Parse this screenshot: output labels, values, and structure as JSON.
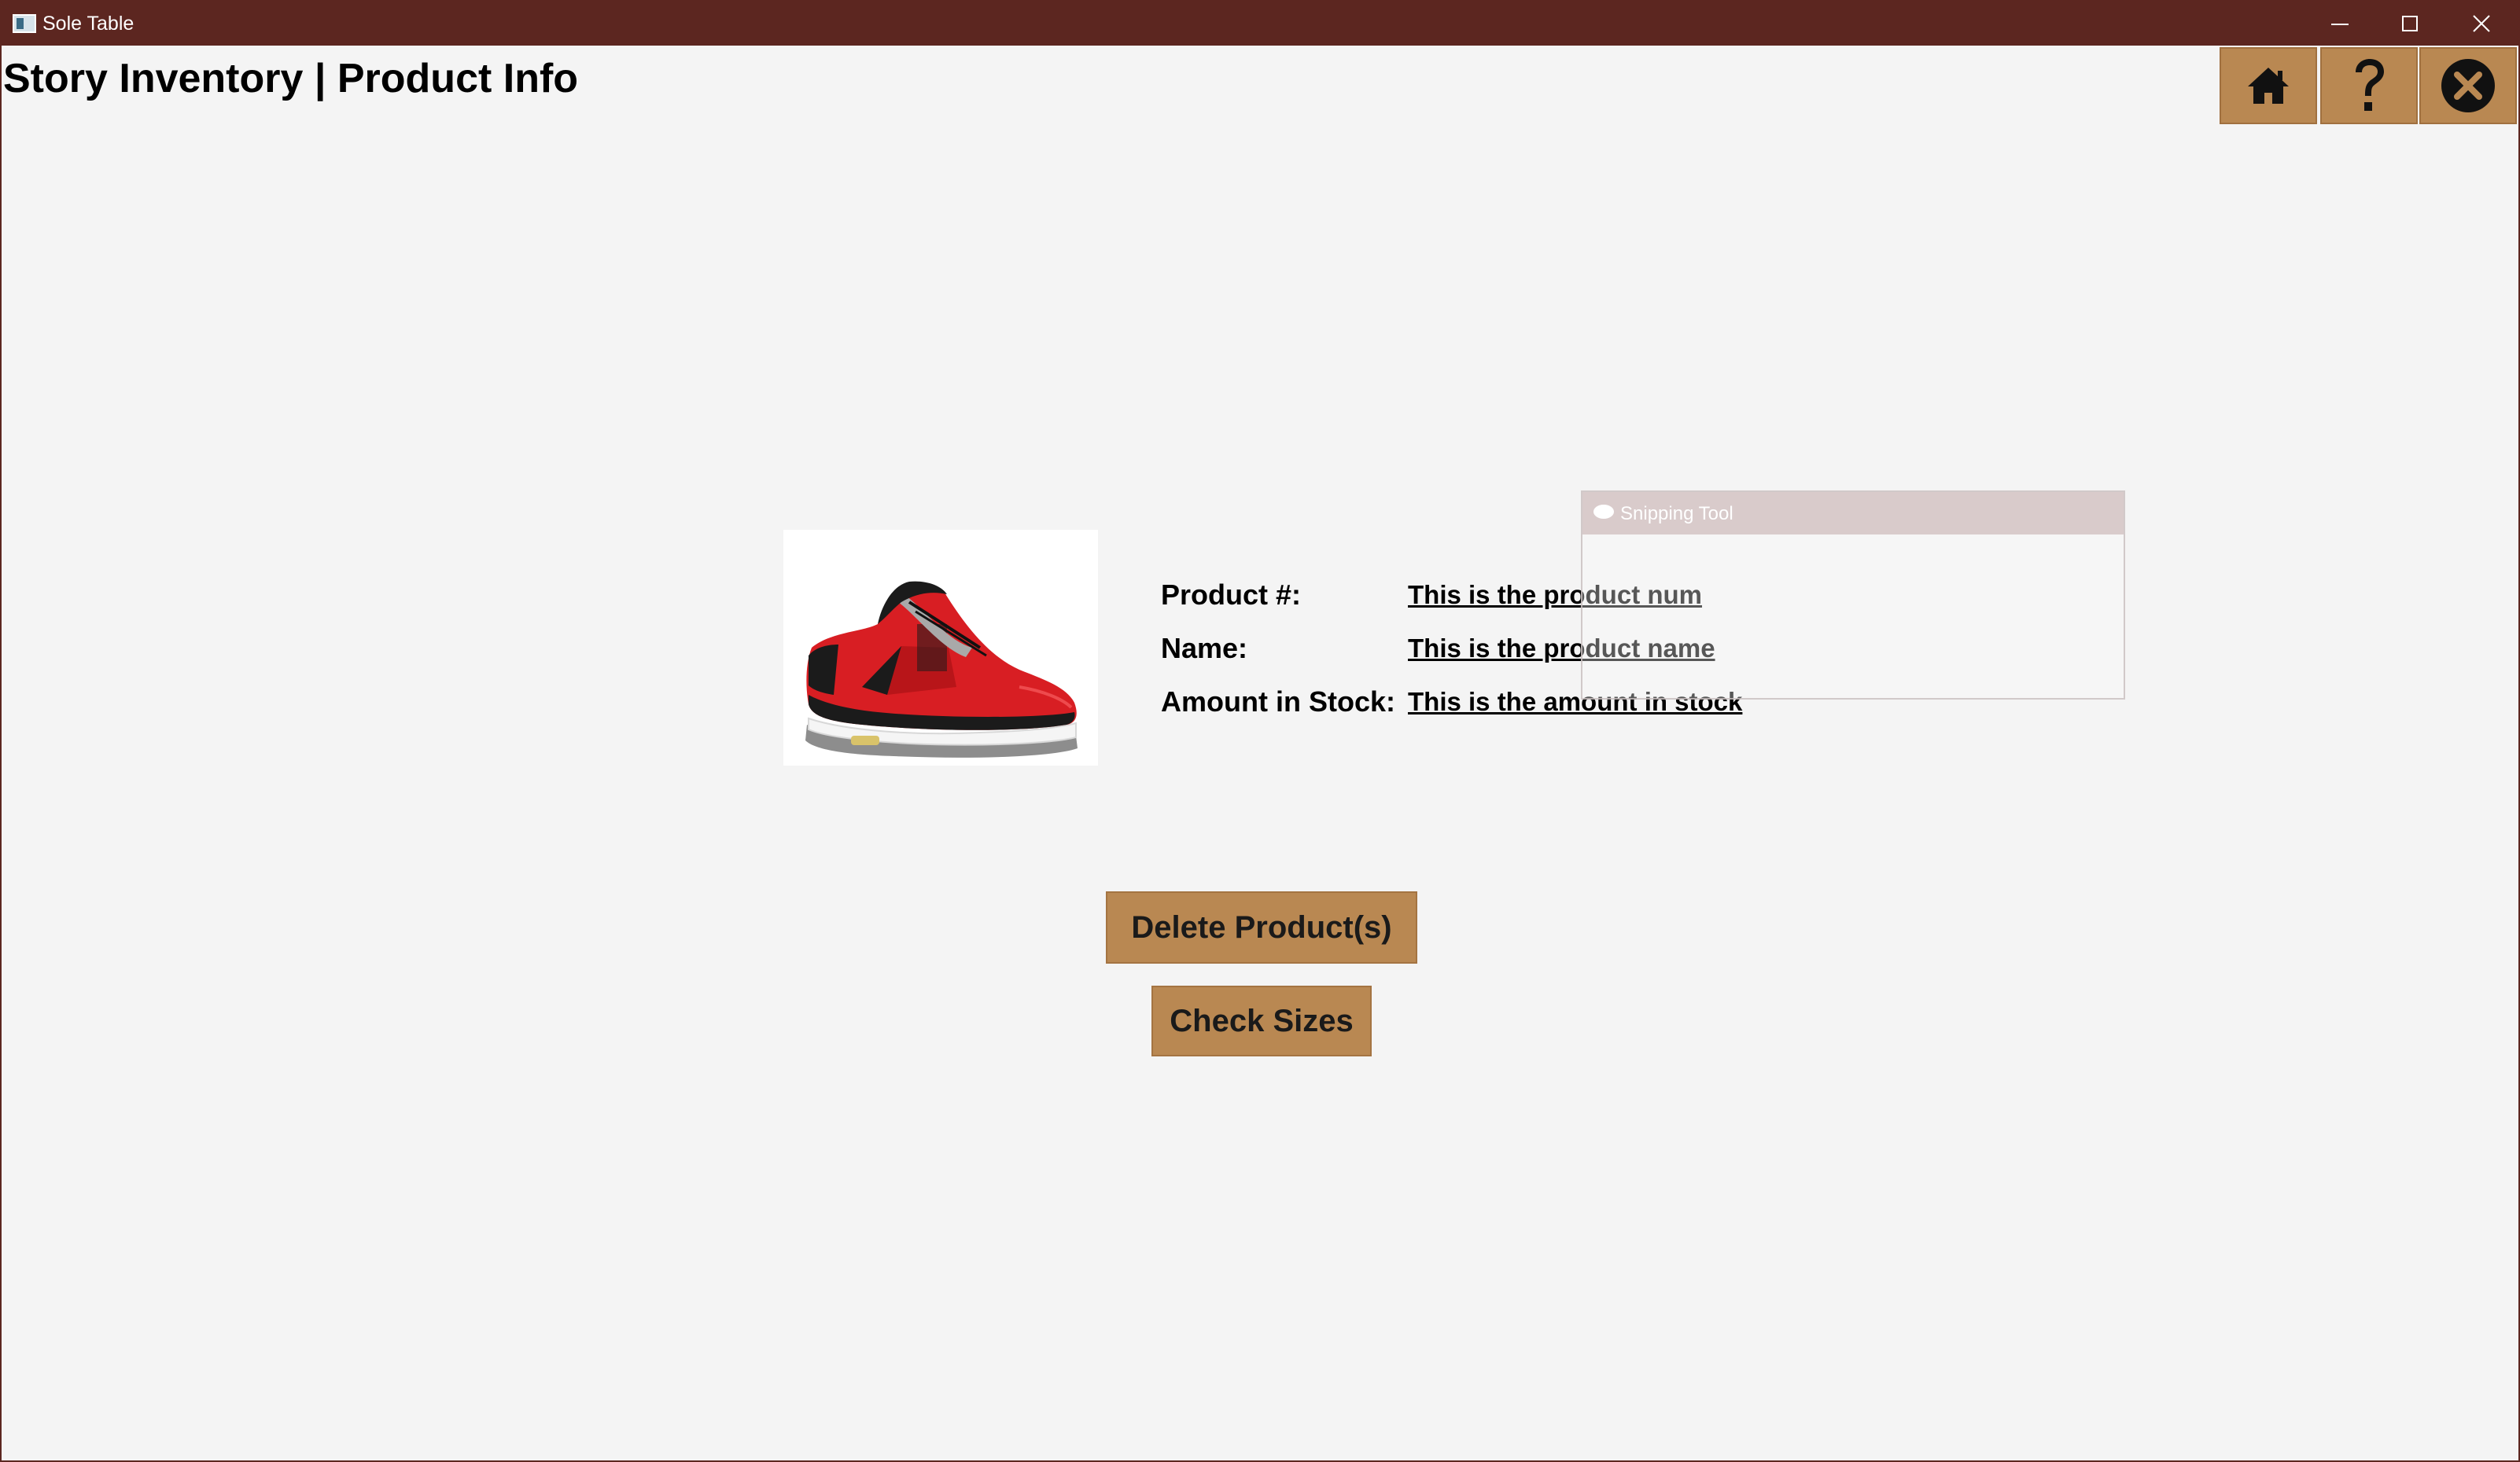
{
  "window": {
    "title": "Sole Table",
    "controls": {
      "minimize_icon": "minimize-icon",
      "maximize_icon": "maximize-icon",
      "close_icon": "close-icon"
    }
  },
  "header": {
    "title": "Story Inventory | Product Info",
    "buttons": {
      "home_icon": "home-icon",
      "help_icon": "question-mark-icon",
      "exit_icon": "circle-x-icon"
    }
  },
  "product": {
    "image": "red-sneaker-image",
    "fields": [
      {
        "label": "Product #:",
        "value": "This is the product num"
      },
      {
        "label": "Name:",
        "value": "This is the product name"
      },
      {
        "label": "Amount in Stock:",
        "value": "This is the amount in stock"
      }
    ]
  },
  "overlay": {
    "title": "Snipping Tool"
  },
  "actions": {
    "delete_label": "Delete Product(s)",
    "check_sizes_label": "Check Sizes"
  },
  "colors": {
    "title_bar": "#5c2620",
    "button_fill": "#b98852",
    "background": "#f4f4f4"
  }
}
